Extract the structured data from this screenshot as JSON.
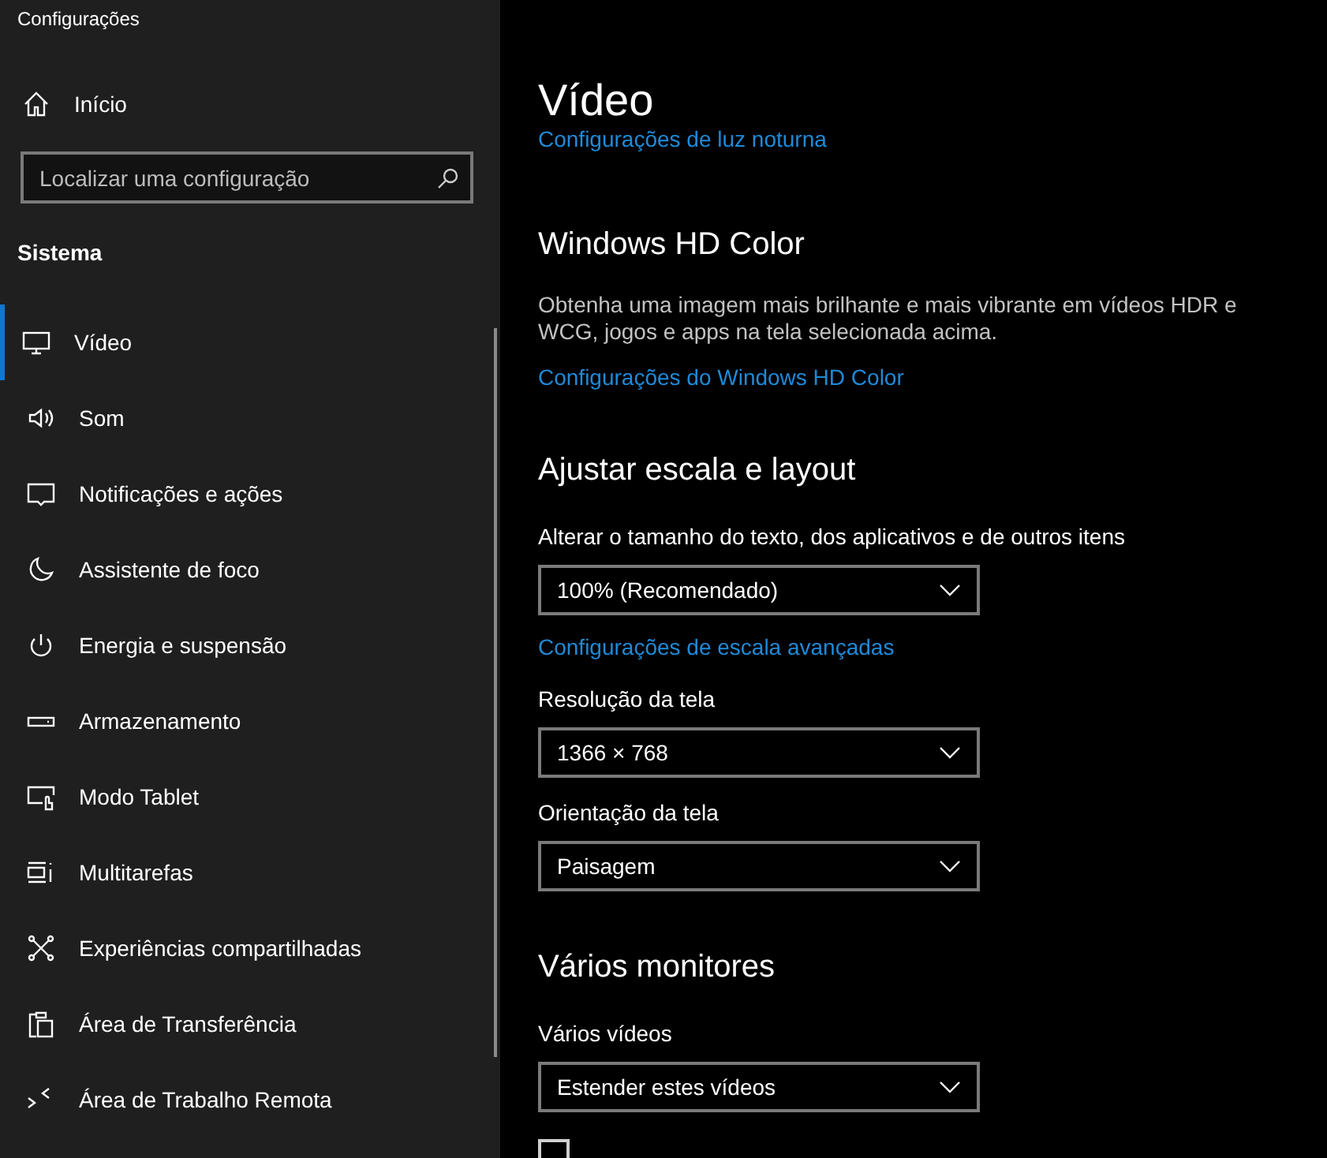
{
  "window": {
    "title": "Configurações"
  },
  "sidebar": {
    "home": "Início",
    "search": {
      "placeholder": "Localizar uma configuração"
    },
    "section": "Sistema",
    "items": [
      {
        "label": "Vídeo",
        "selected": true
      },
      {
        "label": "Som",
        "selected": false
      },
      {
        "label": "Notificações e ações",
        "selected": false
      },
      {
        "label": "Assistente de foco",
        "selected": false
      },
      {
        "label": "Energia e suspensão",
        "selected": false
      },
      {
        "label": "Armazenamento",
        "selected": false
      },
      {
        "label": "Modo Tablet",
        "selected": false
      },
      {
        "label": "Multitarefas",
        "selected": false
      },
      {
        "label": "Experiências compartilhadas",
        "selected": false
      },
      {
        "label": "Área de Transferência",
        "selected": false
      },
      {
        "label": "Área de Trabalho Remota",
        "selected": false
      }
    ]
  },
  "page": {
    "title": "Vídeo",
    "top_link": "Configurações de luz noturna",
    "sections": [
      {
        "heading": "Windows HD Color",
        "blocks": [
          {
            "kind": "text",
            "text": "Obtenha uma imagem mais brilhante e mais vibrante em vídeos HDR e WCG, jogos e apps na tela selecionada acima."
          },
          {
            "kind": "link",
            "text": "Configurações do Windows HD Color"
          }
        ]
      },
      {
        "heading": "Ajustar escala e layout",
        "blocks": [
          {
            "kind": "label",
            "text": "Alterar o tamanho do texto, dos aplicativos e de outros itens"
          },
          {
            "kind": "dropdown",
            "value": "100% (Recomendado)"
          },
          {
            "kind": "link",
            "text": "Configurações de escala avançadas"
          },
          {
            "kind": "label",
            "text": "Resolução da tela"
          },
          {
            "kind": "dropdown",
            "value": "1366 × 768"
          },
          {
            "kind": "label",
            "text": "Orientação da tela"
          },
          {
            "kind": "dropdown",
            "value": "Paisagem"
          }
        ]
      },
      {
        "heading": "Vários monitores",
        "blocks": [
          {
            "kind": "label",
            "text": "Vários vídeos"
          },
          {
            "kind": "dropdown",
            "value": "Estender estes vídeos"
          },
          {
            "kind": "checkbox",
            "checked": false
          }
        ]
      }
    ]
  }
}
